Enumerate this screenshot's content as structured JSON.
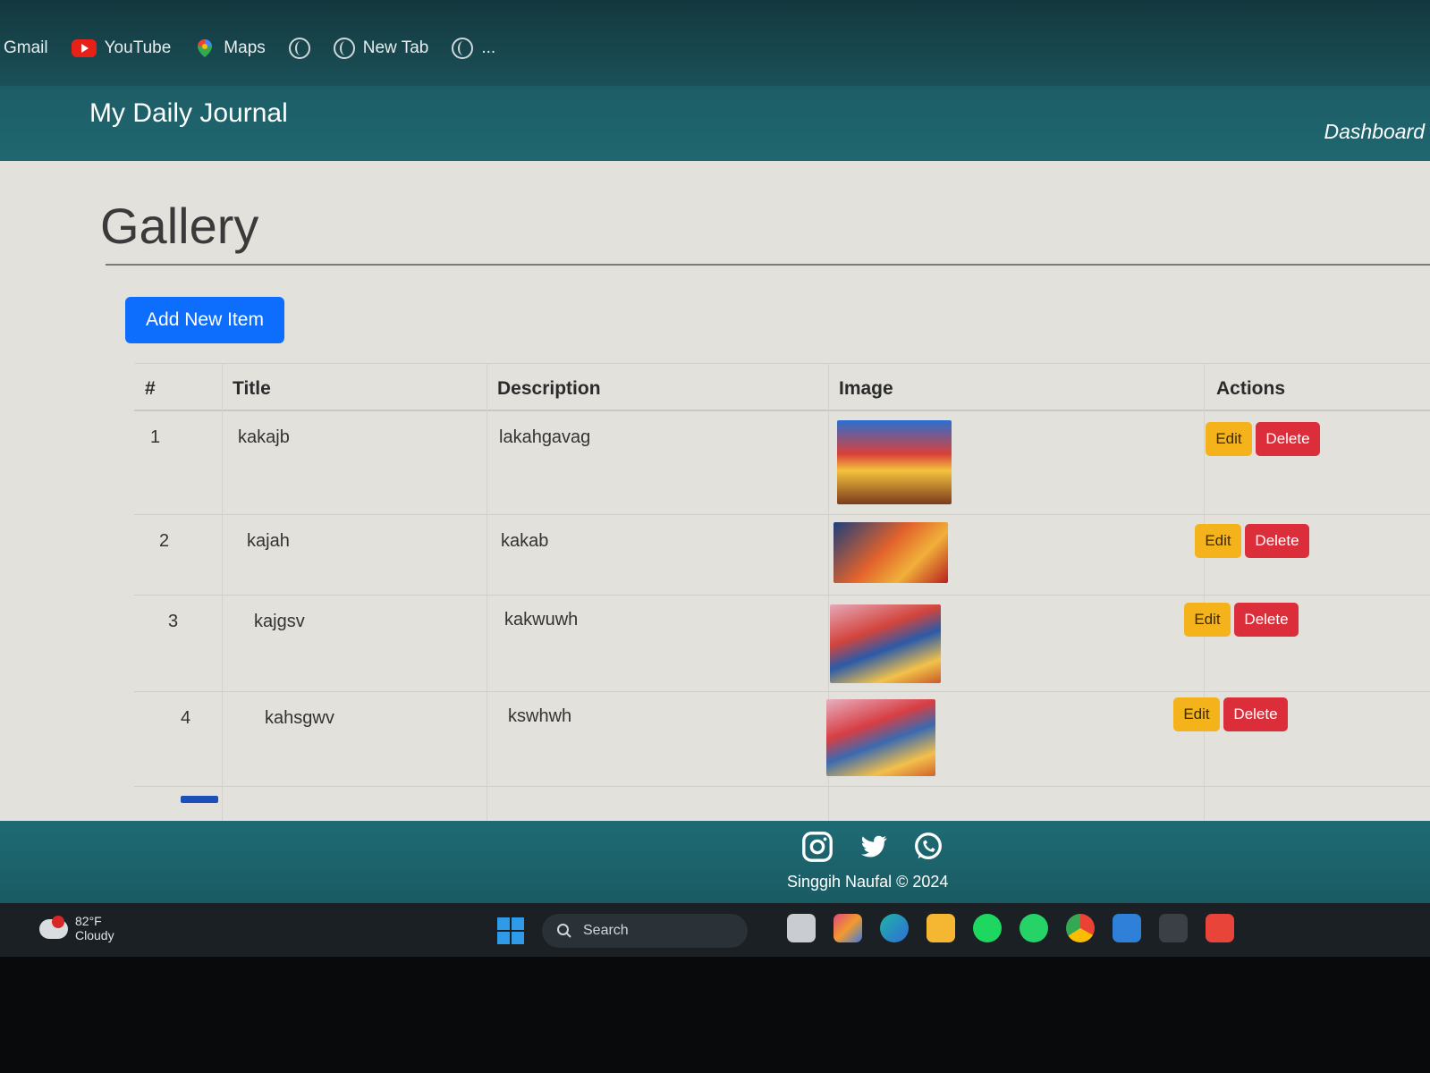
{
  "bookmarks": {
    "items": [
      {
        "label": "Gmail",
        "icon": "gmail-icon"
      },
      {
        "label": "YouTube",
        "icon": "youtube-icon"
      },
      {
        "label": "Maps",
        "icon": "maps-icon"
      },
      {
        "label": "",
        "icon": "globe-icon"
      },
      {
        "label": "New Tab",
        "icon": "globe-icon"
      },
      {
        "label": "...",
        "icon": "globe-icon"
      }
    ]
  },
  "header": {
    "brand": "My Daily Journal",
    "nav_dashboard": "Dashboard"
  },
  "main": {
    "title": "Gallery",
    "add_button": "Add New Item",
    "columns": [
      "#",
      "Title",
      "Description",
      "Image",
      "Actions"
    ],
    "rows": [
      {
        "num": "1",
        "title": "kakajb",
        "description": "lakahgavag",
        "edit": "Edit",
        "delete": "Delete"
      },
      {
        "num": "2",
        "title": "kajah",
        "description": "kakab",
        "edit": "Edit",
        "delete": "Delete"
      },
      {
        "num": "3",
        "title": "kajgsv",
        "description": "kakwuwh",
        "edit": "Edit",
        "delete": "Delete"
      },
      {
        "num": "4",
        "title": "kahsgwv",
        "description": "kswhwh",
        "edit": "Edit",
        "delete": "Delete"
      }
    ]
  },
  "footer": {
    "social_icons": [
      "instagram-icon",
      "twitter-icon",
      "whatsapp-icon"
    ],
    "copyright": "Singgih Naufal © 2024"
  },
  "taskbar": {
    "weather_temp": "82°F",
    "weather_desc": "Cloudy",
    "search_label": "Search"
  },
  "colors": {
    "header": "#1f6770",
    "primary_button": "#0d6efd",
    "edit_button": "#f4b31a",
    "delete_button": "#dc2d3b"
  }
}
